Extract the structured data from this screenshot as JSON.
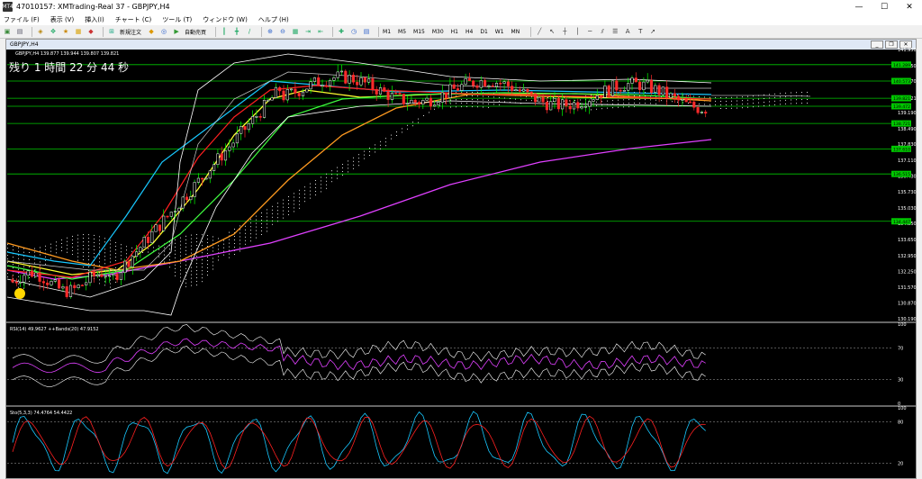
{
  "titlebar": {
    "title": "47010157: XMTrading-Real 37 - GBPJPY,H4",
    "icon_label": "MT4",
    "min": "—",
    "max": "☐",
    "close": "✕"
  },
  "menu": [
    "ファイル (F)",
    "表示 (V)",
    "挿入(I)",
    "チャート (C)",
    "ツール (T)",
    "ウィンドウ (W)",
    "ヘルプ (H)"
  ],
  "toolbar": {
    "new_order": "新規注文",
    "auto_trading": "自動売買",
    "timeframes": [
      "M1",
      "M5",
      "M15",
      "M30",
      "H1",
      "H4",
      "D1",
      "W1",
      "MN"
    ],
    "font_a": "A",
    "text_t": "T"
  },
  "chart_window": {
    "tab_title": "GBPJPY,H4",
    "symbol_info": "GBPJPY,H4  139.877 139.944 139.807 139.821",
    "countdown": "残り 1 時間 22 分 44 秒"
  },
  "price_axis": [
    "141.950",
    "141.250",
    "140.570",
    "139.821",
    "139.190",
    "138.490",
    "137.830",
    "137.110",
    "136.430",
    "135.730",
    "135.030",
    "134.350",
    "133.650",
    "132.950",
    "132.250",
    "131.570",
    "130.870",
    "130.190"
  ],
  "level_tags": [
    "141.289",
    "140.573",
    "139.821",
    "139.472",
    "138.721",
    "137.610",
    "136.515",
    "134.447"
  ],
  "rsi_panel": {
    "label": "RSI(14) 49.9627   ++Bands(20) 47.9152",
    "levels": [
      "100",
      "70",
      "30",
      "0"
    ]
  },
  "stoch_panel": {
    "label": "Sto(5,3,3) 74.4764 54.4422",
    "levels": [
      "100",
      "80",
      "20"
    ]
  },
  "colors": {
    "bg": "#000000",
    "bull": "#00ff00",
    "bear": "#ff2a2a",
    "level_line": "#00c800",
    "cyan": "#18c8ff",
    "magenta": "#e040ff",
    "orange": "#ff9a20",
    "yellow": "#ffff30",
    "ma_red": "#ff2020",
    "cloud": "#dddddd"
  }
}
